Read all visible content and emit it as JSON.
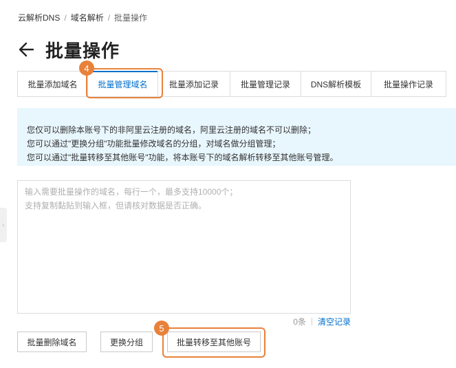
{
  "breadcrumb": {
    "items": [
      "云解析DNS",
      "域名解析",
      "批量操作"
    ],
    "separator": "/"
  },
  "page": {
    "title": "批量操作"
  },
  "tabs": [
    {
      "label": "批量添加域名"
    },
    {
      "label": "批量管理域名"
    },
    {
      "label": "批量添加记录"
    },
    {
      "label": "批量管理记录"
    },
    {
      "label": "DNS解析模板"
    },
    {
      "label": "批量操作记录"
    }
  ],
  "active_tab": "批量管理域名",
  "steps": {
    "tab_step": "4",
    "button_step": "5"
  },
  "notice": {
    "lines": [
      "您仅可以删除本账号下的非阿里云注册的域名，阿里云注册的域名不可以删除；",
      "您可以通过\"更换分组\"功能批量修改域名的分组，对域名做分组管理；",
      "您可以通过\"批量转移至其他账号\"功能，将本账号下的域名解析转移至其他账号管理。"
    ]
  },
  "input": {
    "value": "",
    "placeholder": "输入需要批量操作的域名，每行一个，最多支持10000个；\n支持复制黏贴到输入框，但请核对数据是否正确。"
  },
  "counter": {
    "count_text": "0条",
    "clear_label": "清空记录"
  },
  "buttons": {
    "delete_label": "批量删除域名",
    "change_group_label": "更换分组",
    "transfer_label": "批量转移至其他账号"
  },
  "colors": {
    "accent": "#0070cc",
    "highlight": "#e8813a",
    "notice_bg": "#e8f6fd"
  }
}
